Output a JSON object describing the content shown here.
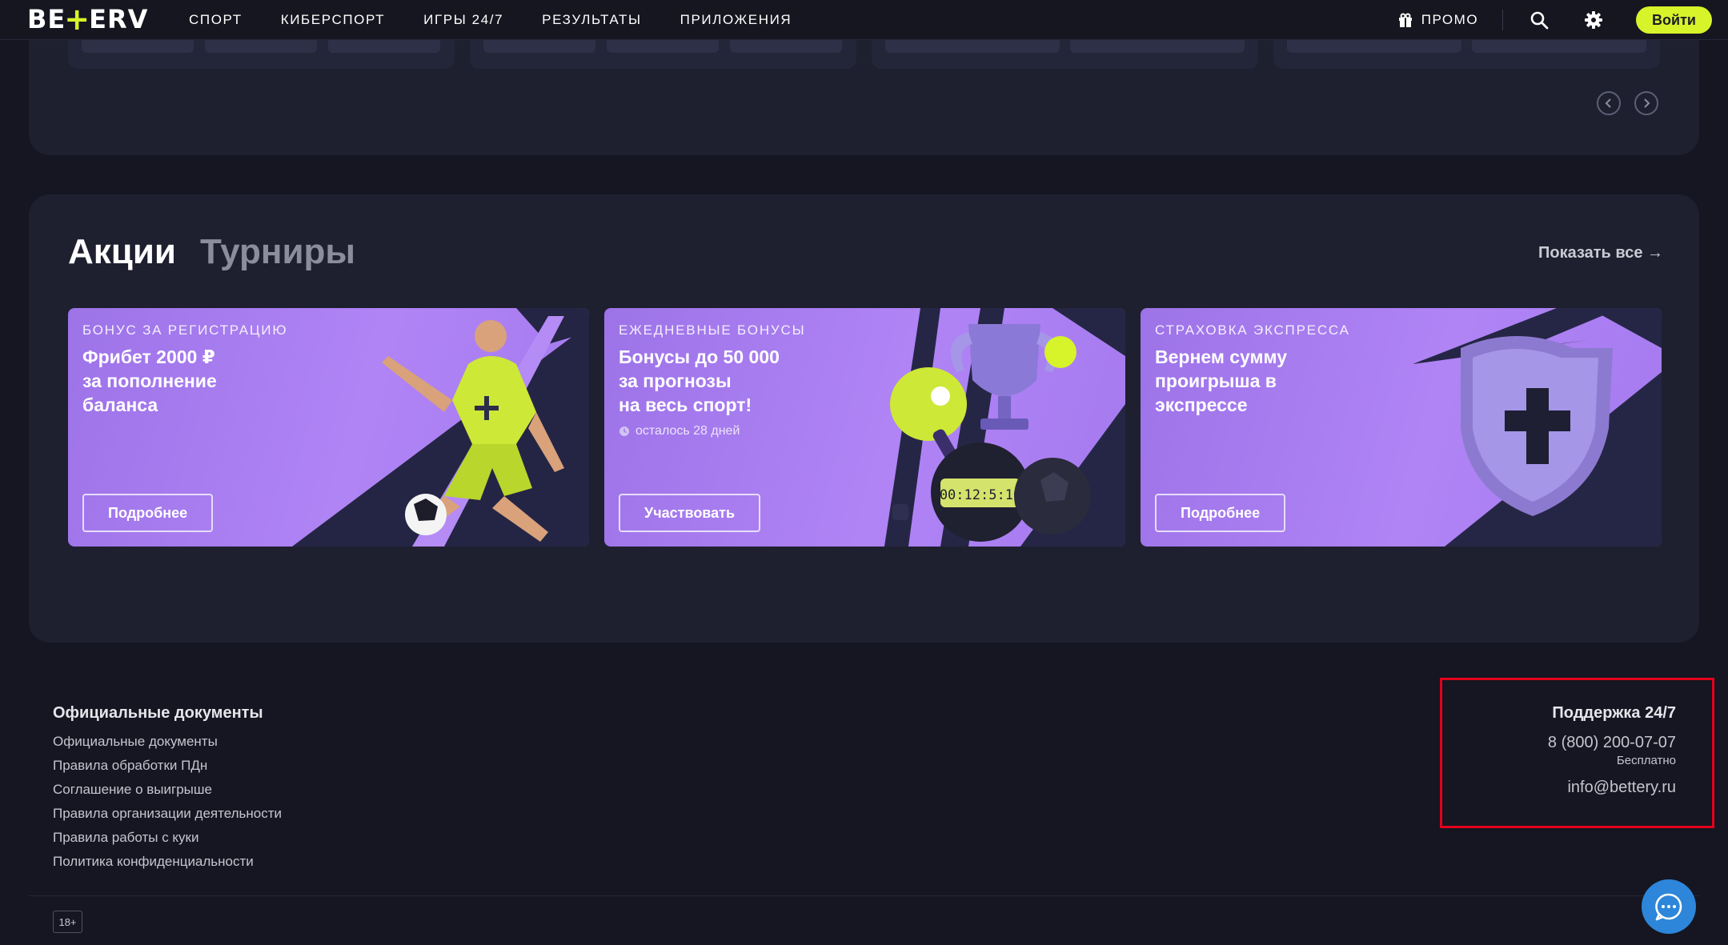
{
  "header": {
    "logo_left": "BE",
    "logo_plus": "+",
    "logo_right": "ERV",
    "nav": [
      "СПОРТ",
      "КИБЕРСПОРТ",
      "ИГРЫ 24/7",
      "РЕЗУЛЬТАТЫ",
      "ПРИЛОЖЕНИЯ"
    ],
    "promo_label": "ПРОМО",
    "login_label": "Войти",
    "icons": [
      "gift-icon",
      "search-icon",
      "gear-icon"
    ]
  },
  "promotions": {
    "tab_active": "Акции",
    "tab_inactive": "Турниры",
    "show_all": "Показать все →",
    "banners": [
      {
        "kicker": "БОНУС ЗА РЕГИСТРАЦИЮ",
        "title": "Фрибет 2000 ₽\nза пополнение\nбаланса",
        "subtitle": "",
        "button": "Подробнее"
      },
      {
        "kicker": "ЕЖЕДНЕВНЫЕ БОНУСЫ",
        "title": "Бонусы до 50 000\nза прогнозы\nна весь спорт!",
        "subtitle": "осталось 28 дней",
        "button": "Участвовать",
        "timer_text": "00:12:5:10"
      },
      {
        "kicker": "СТРАХОВКА ЭКСПРЕССА",
        "title": "Вернем сумму\nпроигрыша в\nэкспрессе",
        "subtitle": "",
        "button": "Подробнее"
      }
    ]
  },
  "footer": {
    "docs_title": "Официальные документы",
    "docs": [
      "Официальные документы",
      "Правила обработки ПДн",
      "Соглашение о выигрыше",
      "Правила организации деятельности",
      "Правила работы с куки",
      "Политика конфиденциальности"
    ],
    "support_title": "Поддержка 24/7",
    "phone": "8 (800) 200-07-07",
    "phone_note": "Бесплатно",
    "email": "info@bettery.ru",
    "age_label": "18+"
  },
  "colors": {
    "background": "#151621",
    "card": "#1e2030",
    "accent": "#d7f32a",
    "banner": "#a97cf1",
    "highlight": "#e3001b",
    "chat": "#2d86d9"
  }
}
